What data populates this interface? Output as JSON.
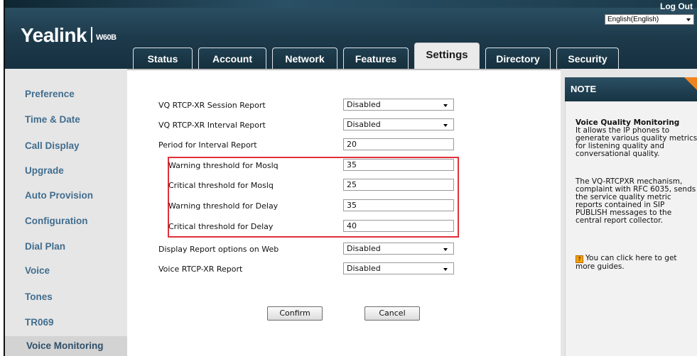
{
  "header": {
    "logo_brand": "Yealink",
    "logo_model": "W60B",
    "logout": "Log Out",
    "language": "English(English)"
  },
  "tabs": [
    {
      "label": "Status",
      "active": false
    },
    {
      "label": "Account",
      "active": false
    },
    {
      "label": "Network",
      "active": false
    },
    {
      "label": "Features",
      "active": false
    },
    {
      "label": "Settings",
      "active": true
    },
    {
      "label": "Directory",
      "active": false
    },
    {
      "label": "Security",
      "active": false
    }
  ],
  "sidebar": {
    "items": [
      {
        "label": "Preference"
      },
      {
        "label": "Time & Date"
      },
      {
        "label": "Call Display"
      },
      {
        "label": "Upgrade"
      },
      {
        "label": "Auto Provision"
      },
      {
        "label": "Configuration"
      },
      {
        "label": "Dial Plan"
      },
      {
        "label": "Voice"
      },
      {
        "label": "Tones"
      },
      {
        "label": "TR069"
      },
      {
        "label": "Voice Monitoring",
        "active": true
      }
    ]
  },
  "form": {
    "fields": [
      {
        "label": "VQ RTCP-XR Session Report",
        "type": "select",
        "value": "Disabled"
      },
      {
        "label": "VQ RTCP-XR Interval Report",
        "type": "select",
        "value": "Disabled"
      },
      {
        "label": "Period for Interval Report",
        "type": "input",
        "value": "20"
      },
      {
        "label": "Warning threshold for Moslq",
        "type": "input",
        "value": "35"
      },
      {
        "label": "Critical threshold for Moslq",
        "type": "input",
        "value": "25"
      },
      {
        "label": "Warning threshold for Delay",
        "type": "input",
        "value": "35"
      },
      {
        "label": "Critical threshold for Delay",
        "type": "input",
        "value": "40"
      },
      {
        "label": "Display Report options on Web",
        "type": "select",
        "value": "Disabled"
      },
      {
        "label": "Voice RTCP-XR Report",
        "type": "select",
        "value": "Disabled"
      }
    ],
    "confirm": "Confirm",
    "cancel": "Cancel",
    "highlight_color": "#e0303a"
  },
  "note": {
    "title": "NOTE",
    "heading": "Voice Quality Monitoring",
    "para1": "It allows the IP phones to generate various quality metrics for listening quality and conversational quality.",
    "para2": "The VQ-RTCPXR mechanism, complaint with RFC 6035, sends the service quality metric reports contained in SIP PUBLISH messages to the central report collector.",
    "guide": "You can click here to get more guides.",
    "guide_icon_glyph": "?",
    "accent_color": "#f0831e"
  }
}
